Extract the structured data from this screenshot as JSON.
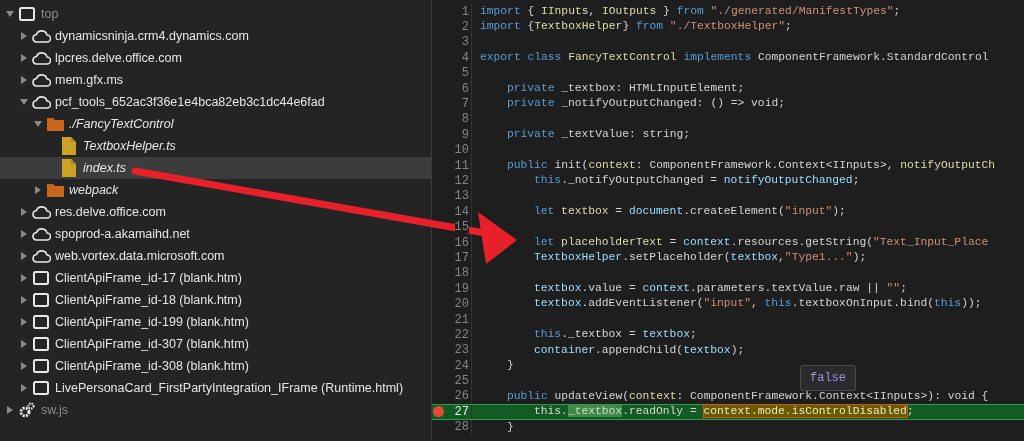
{
  "tree": [
    {
      "label": "top",
      "kind": "frame",
      "dimmed": true,
      "selected": false,
      "expanded": true,
      "children": [
        {
          "label": "dynamicsninja.crm4.dynamics.com",
          "kind": "host",
          "dimmed": false,
          "selected": false,
          "expanded": false
        },
        {
          "label": "lpcres.delve.office.com",
          "kind": "host",
          "dimmed": false,
          "selected": false,
          "expanded": false
        },
        {
          "label": "mem.gfx.ms",
          "kind": "host",
          "dimmed": false,
          "selected": false,
          "expanded": false
        },
        {
          "label": "pcf_tools_652ac3f36e1e4bca82eb3c1dc44e6fad",
          "kind": "host",
          "dimmed": false,
          "selected": false,
          "expanded": true,
          "children": [
            {
              "label": "./FancyTextControl",
              "kind": "folder",
              "dimmed": false,
              "selected": false,
              "expanded": true,
              "children": [
                {
                  "label": "TextboxHelper.ts",
                  "kind": "file",
                  "dimmed": false,
                  "selected": false
                },
                {
                  "label": "index.ts",
                  "kind": "file",
                  "dimmed": false,
                  "selected": true
                }
              ]
            },
            {
              "label": "webpack",
              "kind": "folder",
              "dimmed": false,
              "selected": false,
              "expanded": false
            }
          ]
        },
        {
          "label": "res.delve.office.com",
          "kind": "host",
          "dimmed": false,
          "selected": false,
          "expanded": false
        },
        {
          "label": "spoprod-a.akamaihd.net",
          "kind": "host",
          "dimmed": false,
          "selected": false,
          "expanded": false
        },
        {
          "label": "web.vortex.data.microsoft.com",
          "kind": "host",
          "dimmed": false,
          "selected": false,
          "expanded": false
        },
        {
          "label": "ClientApiFrame_id-17 (blank.htm)",
          "kind": "frame",
          "dimmed": false,
          "selected": false,
          "expanded": false
        },
        {
          "label": "ClientApiFrame_id-18 (blank.htm)",
          "kind": "frame",
          "dimmed": false,
          "selected": false,
          "expanded": false
        },
        {
          "label": "ClientApiFrame_id-199 (blank.htm)",
          "kind": "frame",
          "dimmed": false,
          "selected": false,
          "expanded": false
        },
        {
          "label": "ClientApiFrame_id-307 (blank.htm)",
          "kind": "frame",
          "dimmed": false,
          "selected": false,
          "expanded": false
        },
        {
          "label": "ClientApiFrame_id-308 (blank.htm)",
          "kind": "frame",
          "dimmed": false,
          "selected": false,
          "expanded": false
        },
        {
          "label": "LivePersonaCard_FirstPartyIntegration_IFrame (Runtime.html)",
          "kind": "frame",
          "dimmed": false,
          "selected": false,
          "expanded": false
        }
      ]
    },
    {
      "label": "sw.js",
      "kind": "worker",
      "dimmed": true,
      "selected": false,
      "expanded": false
    }
  ],
  "editor": {
    "lines": [
      {
        "number": "1",
        "breakpoint": false,
        "current": false,
        "tokens": [
          {
            "text": "import",
            "kind": "keyword"
          },
          {
            "text": " { ",
            "kind": "plain"
          },
          {
            "text": "IInputs",
            "kind": "type"
          },
          {
            "text": ", ",
            "kind": "plain"
          },
          {
            "text": "IOutputs",
            "kind": "type"
          },
          {
            "text": " } ",
            "kind": "plain"
          },
          {
            "text": "from",
            "kind": "keyword"
          },
          {
            "text": " \"./generated/ManifestTypes\"",
            "kind": "string"
          },
          {
            "text": ";",
            "kind": "plain"
          }
        ]
      },
      {
        "number": "2",
        "breakpoint": false,
        "current": false,
        "tokens": [
          {
            "text": "import",
            "kind": "keyword"
          },
          {
            "text": " {",
            "kind": "plain"
          },
          {
            "text": "TextboxHelper",
            "kind": "type"
          },
          {
            "text": "} ",
            "kind": "plain"
          },
          {
            "text": "from",
            "kind": "keyword"
          },
          {
            "text": " \"./TextboxHelper\"",
            "kind": "string"
          },
          {
            "text": ";",
            "kind": "plain"
          }
        ]
      },
      {
        "number": "3",
        "breakpoint": false,
        "current": false
      },
      {
        "number": "4",
        "breakpoint": false,
        "current": false,
        "tokens": [
          {
            "text": "export class",
            "kind": "keyword"
          },
          {
            "text": " FancyTextControl",
            "kind": "type"
          },
          {
            "text": " implements",
            "kind": "keyword"
          },
          {
            "text": " ComponentFramework.StandardControl",
            "kind": "plain"
          }
        ],
        "children": [
          {
            "number": "5",
            "breakpoint": false,
            "current": false
          },
          {
            "number": "6",
            "breakpoint": false,
            "current": false,
            "tokens": [
              {
                "text": "private",
                "kind": "keyword"
              },
              {
                "text": " _textbox: HTMLInputElement;",
                "kind": "plain"
              }
            ]
          },
          {
            "number": "7",
            "breakpoint": false,
            "current": false,
            "tokens": [
              {
                "text": "private",
                "kind": "keyword"
              },
              {
                "text": " _notifyOutputChanged: () => void;",
                "kind": "plain"
              }
            ]
          },
          {
            "number": "8",
            "breakpoint": false,
            "current": false
          },
          {
            "number": "9",
            "breakpoint": false,
            "current": false,
            "tokens": [
              {
                "text": "private",
                "kind": "keyword"
              },
              {
                "text": " _textValue: string;",
                "kind": "plain"
              }
            ]
          },
          {
            "number": "10",
            "breakpoint": false,
            "current": false
          },
          {
            "number": "11",
            "breakpoint": false,
            "current": false,
            "tokens": [
              {
                "text": "public",
                "kind": "keyword"
              },
              {
                "text": " init(",
                "kind": "plain"
              },
              {
                "text": "context",
                "kind": "type"
              },
              {
                "text": ": ComponentFramework.Context<IInputs>, ",
                "kind": "plain"
              },
              {
                "text": "notifyOutputCh",
                "kind": "type"
              }
            ],
            "children": [
              {
                "number": "12",
                "breakpoint": false,
                "current": false,
                "tokens": [
                  {
                    "text": "this",
                    "kind": "keyword"
                  },
                  {
                    "text": "._notifyOutputChanged = ",
                    "kind": "plain"
                  },
                  {
                    "text": "notifyOutputChanged",
                    "kind": "variable"
                  },
                  {
                    "text": ";",
                    "kind": "plain"
                  }
                ]
              },
              {
                "number": "13",
                "breakpoint": false,
                "current": false
              },
              {
                "number": "14",
                "breakpoint": false,
                "current": false,
                "tokens": [
                  {
                    "text": "let",
                    "kind": "keyword"
                  },
                  {
                    "text": " textbox",
                    "kind": "type"
                  },
                  {
                    "text": " = ",
                    "kind": "plain"
                  },
                  {
                    "text": "document",
                    "kind": "variable"
                  },
                  {
                    "text": ".createElement(",
                    "kind": "plain"
                  },
                  {
                    "text": "\"input\"",
                    "kind": "string"
                  },
                  {
                    "text": ");",
                    "kind": "plain"
                  }
                ]
              },
              {
                "number": "15",
                "breakpoint": false,
                "current": false
              },
              {
                "number": "16",
                "breakpoint": false,
                "current": false,
                "tokens": [
                  {
                    "text": "let",
                    "kind": "keyword"
                  },
                  {
                    "text": " placeholderText",
                    "kind": "type"
                  },
                  {
                    "text": " = ",
                    "kind": "plain"
                  },
                  {
                    "text": "context",
                    "kind": "variable"
                  },
                  {
                    "text": ".resources.getString(",
                    "kind": "plain"
                  },
                  {
                    "text": "\"Text_Input_Place",
                    "kind": "string"
                  }
                ]
              },
              {
                "number": "17",
                "breakpoint": false,
                "current": false,
                "tokens": [
                  {
                    "text": "TextboxHelper",
                    "kind": "variable"
                  },
                  {
                    "text": ".setPlaceholder(",
                    "kind": "plain"
                  },
                  {
                    "text": "textbox",
                    "kind": "variable"
                  },
                  {
                    "text": ",",
                    "kind": "plain"
                  },
                  {
                    "text": "\"Type1...\"",
                    "kind": "string"
                  },
                  {
                    "text": ");",
                    "kind": "plain"
                  }
                ]
              },
              {
                "number": "18",
                "breakpoint": false,
                "current": false
              },
              {
                "number": "19",
                "breakpoint": false,
                "current": false,
                "tokens": [
                  {
                    "text": "textbox",
                    "kind": "variable"
                  },
                  {
                    "text": ".value = ",
                    "kind": "plain"
                  },
                  {
                    "text": "context",
                    "kind": "variable"
                  },
                  {
                    "text": ".parameters.textValue.raw || ",
                    "kind": "plain"
                  },
                  {
                    "text": "\"\"",
                    "kind": "string"
                  },
                  {
                    "text": ";",
                    "kind": "plain"
                  }
                ]
              },
              {
                "number": "20",
                "breakpoint": false,
                "current": false,
                "tokens": [
                  {
                    "text": "textbox",
                    "kind": "variable"
                  },
                  {
                    "text": ".addEventListener(",
                    "kind": "plain"
                  },
                  {
                    "text": "\"input\"",
                    "kind": "string"
                  },
                  {
                    "text": ", ",
                    "kind": "plain"
                  },
                  {
                    "text": "this",
                    "kind": "keyword"
                  },
                  {
                    "text": ".textboxOnInput.bind(",
                    "kind": "plain"
                  },
                  {
                    "text": "this",
                    "kind": "keyword"
                  },
                  {
                    "text": "));",
                    "kind": "plain"
                  }
                ]
              },
              {
                "number": "21",
                "breakpoint": false,
                "current": false
              },
              {
                "number": "22",
                "breakpoint": false,
                "current": false,
                "tokens": [
                  {
                    "text": "this",
                    "kind": "keyword"
                  },
                  {
                    "text": "._textbox = ",
                    "kind": "plain"
                  },
                  {
                    "text": "textbox",
                    "kind": "variable"
                  },
                  {
                    "text": ";",
                    "kind": "plain"
                  }
                ]
              },
              {
                "number": "23",
                "breakpoint": false,
                "current": false,
                "tokens": [
                  {
                    "text": "container",
                    "kind": "variable"
                  },
                  {
                    "text": ".appendChild(",
                    "kind": "plain"
                  },
                  {
                    "text": "textbox",
                    "kind": "variable"
                  },
                  {
                    "text": ");",
                    "kind": "plain"
                  }
                ]
              }
            ]
          },
          {
            "number": "24",
            "breakpoint": false,
            "current": false,
            "tokens": [
              {
                "text": "}",
                "kind": "plain"
              }
            ]
          },
          {
            "number": "25",
            "breakpoint": false,
            "current": false
          },
          {
            "number": "26",
            "breakpoint": false,
            "current": false,
            "tokens": [
              {
                "text": "public",
                "kind": "keyword"
              },
              {
                "text": " updateView(",
                "kind": "plain"
              },
              {
                "text": "context",
                "kind": "type"
              },
              {
                "text": ": ComponentFramework.Context<IInputs>): void {",
                "kind": "plain"
              }
            ],
            "children": [
              {
                "number": "27",
                "breakpoint": true,
                "current": true,
                "tokens": [
                  {
                    "text": "this.",
                    "kind": "plain"
                  },
                  {
                    "text": "_textbox",
                    "kind": "current-word"
                  },
                  {
                    "text": ".readOnly = ",
                    "kind": "plain"
                  },
                  {
                    "text": "context.mode.isControlDisabled",
                    "kind": "evaluated"
                  },
                  {
                    "text": ";",
                    "kind": "plain"
                  }
                ]
              }
            ]
          },
          {
            "number": "28",
            "breakpoint": false,
            "current": false,
            "tokens": [
              {
                "text": "}",
                "kind": "plain"
              }
            ]
          }
        ]
      }
    ],
    "tooltip": {
      "text": "false"
    }
  }
}
